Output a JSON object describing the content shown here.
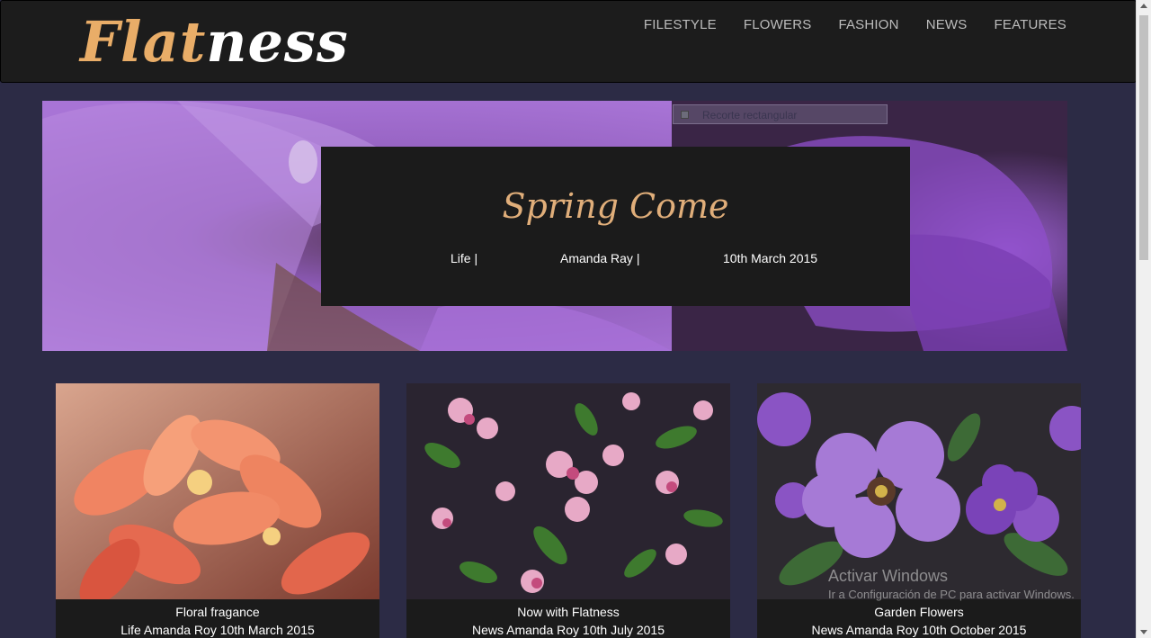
{
  "logo": {
    "part1": "Flat",
    "part2": "ness"
  },
  "nav": [
    {
      "label": "FILESTYLE"
    },
    {
      "label": "FLOWERS"
    },
    {
      "label": "FASHION"
    },
    {
      "label": "NEWS"
    },
    {
      "label": "FEATURES"
    }
  ],
  "hero": {
    "title": "Spring Come",
    "category": "Life |",
    "author": "Amanda Ray |",
    "date": "10th March 2015",
    "snip_label": "Recorte rectangular"
  },
  "cards": [
    {
      "title": "Floral fragance",
      "meta": "Life Amanda Roy 10th March 2015"
    },
    {
      "title": "Now with Flatness",
      "meta": "News Amanda Roy 10th July 2015"
    },
    {
      "title": "Garden Flowers",
      "meta": "News Amanda Roy 10th October 2015"
    }
  ],
  "watermark": {
    "line1": "Activar Windows",
    "line2": "Ir a Configuración de PC para activar Windows."
  },
  "colors": {
    "background": "#2c2b45",
    "header": "#1c1c1c",
    "accent": "#e9ad68",
    "overlay": "#1b1b1b"
  }
}
